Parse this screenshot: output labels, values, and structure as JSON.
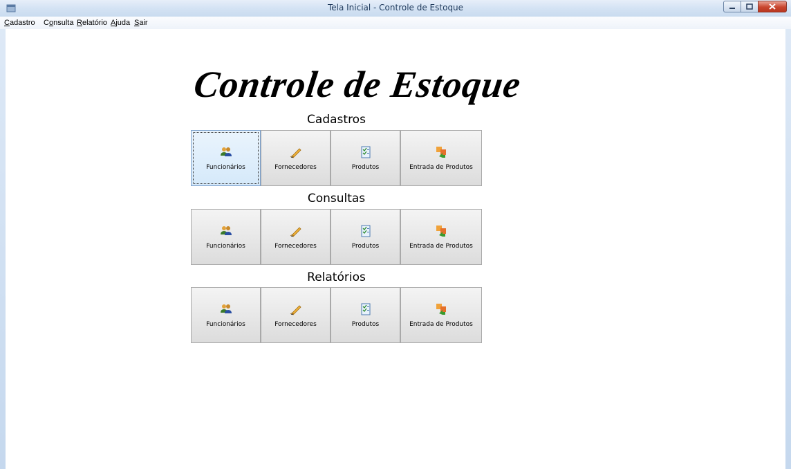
{
  "window": {
    "title": "Tela Inicial - Controle de Estoque"
  },
  "menu": [
    {
      "accel": "C",
      "rest": "adastro"
    },
    {
      "accel": "C",
      "pre": "",
      "rest": "onsulta",
      "underline_index": 1
    },
    {
      "accel": "R",
      "rest": "elatório"
    },
    {
      "accel": "A",
      "rest": "juda"
    },
    {
      "accel": "S",
      "rest": "air"
    }
  ],
  "menu_text": {
    "cadastro_a": "C",
    "cadastro_b": "adastro",
    "consulta_a": "C",
    "consulta_b": "o",
    "consulta_c": "nsulta",
    "relatorio_a": "R",
    "relatorio_b": "elatório",
    "ajuda_a": "A",
    "ajuda_b": "juda",
    "sair_a": "S",
    "sair_b": "air"
  },
  "heading": "Controle de Estoque",
  "sections": [
    {
      "title": "Cadastros",
      "buttons": [
        "Funcionários",
        "Fornecedores",
        "Produtos",
        "Entrada de Produtos"
      ]
    },
    {
      "title": "Consultas",
      "buttons": [
        "Funcionários",
        "Fornecedores",
        "Produtos",
        "Entrada de Produtos"
      ]
    },
    {
      "title": "Relatórios",
      "buttons": [
        "Funcionários",
        "Fornecedores",
        "Produtos",
        "Entrada de Produtos"
      ]
    }
  ],
  "icons": [
    "users-icon",
    "pen-icon",
    "checklist-icon",
    "import-icon"
  ]
}
